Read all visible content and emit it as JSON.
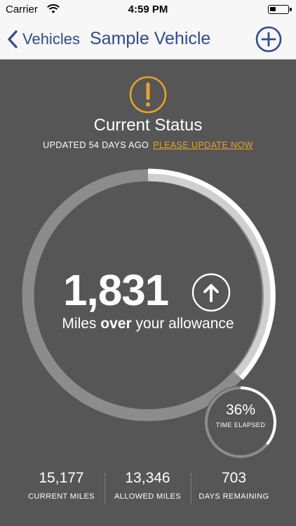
{
  "status_bar": {
    "carrier": "Carrier",
    "time": "4:59 PM"
  },
  "nav": {
    "back_label": "Vehicles",
    "title": "Sample Vehicle"
  },
  "status": {
    "heading": "Current Status",
    "updated_text": "UPDATED 54 DAYS AGO",
    "update_link": "PLEASE UPDATE NOW",
    "warning_color": "#e8a426"
  },
  "allowance": {
    "miles_value": "1,831",
    "caption_prefix": "Miles",
    "caption_emphasis": "over",
    "caption_suffix": "your allowance",
    "direction_icon": "arrow-up-icon"
  },
  "time_elapsed": {
    "percent_text": "36%",
    "label": "TIME ELAPSED",
    "fraction": 0.36
  },
  "stats": [
    {
      "value": "15,177",
      "label": "CURRENT MILES"
    },
    {
      "value": "13,346",
      "label": "ALLOWED MILES"
    },
    {
      "value": "703",
      "label": "DAYS REMAINING"
    }
  ],
  "colors": {
    "accent": "#2f4a8f",
    "background": "#565656"
  }
}
